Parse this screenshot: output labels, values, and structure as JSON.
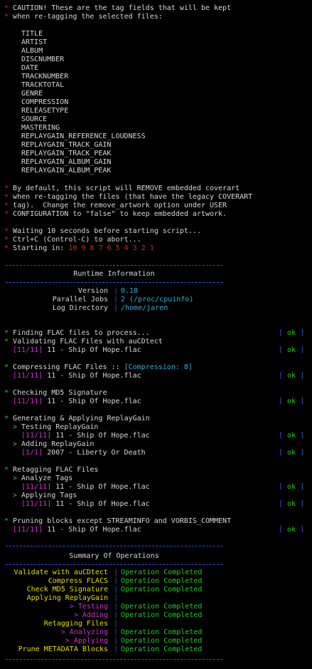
{
  "caution": {
    "line1": "CAUTION! These are the tag fields that will be kept",
    "line2": "when re-tagging the selected files:",
    "tags": [
      "TITLE",
      "ARTIST",
      "ALBUM",
      "DISCNUMBER",
      "DATE",
      "TRACKNUMBER",
      "TRACKTOTAL",
      "GENRE",
      "COMPRESSION",
      "RELEASETYPE",
      "SOURCE",
      "MASTERING",
      "REPLAYGAIN_REFERENCE_LOUDNESS",
      "REPLAYGAIN_TRACK_GAIN",
      "REPLAYGAIN_TRACK_PEAK",
      "REPLAYGAIN_ALBUM_GAIN",
      "REPLAYGAIN_ALBUM_PEAK"
    ]
  },
  "coverart": [
    "By default, this script will REMOVE embedded coverart",
    "when re-tagging the files (that have the legacy COVERART",
    "tag).  Change the remove_artwork option under USER",
    "CONFIGURATION to \"false\" to keep embedded artwork."
  ],
  "waiting": {
    "line1": "Waiting 10 seconds before starting script...",
    "line2": "Ctrl+C (Control-C) to abort...",
    "line3": "Starting in: ",
    "countdown": "10 9 8 7 6 5 4 3 2 1"
  },
  "runtime": {
    "title": "Runtime Information",
    "rows": [
      {
        "label": "Version",
        "value": "0.18"
      },
      {
        "label": "Parallel Jobs",
        "value": "2 (/proc/cpuinfo)"
      },
      {
        "label": "Log Directory",
        "value": "/home/jaren"
      }
    ]
  },
  "ok_label": "[ ok ]",
  "steps": {
    "finding": "Finding FLAC files to process...",
    "validating": "Validating FLAC Files with auCDtect",
    "counter": "[11/11]",
    "file": "11 - Ship Of Hope.flac",
    "compressing": "Compressing FLAC Files :: ",
    "compression_tag": "[Compression: 8]",
    "md5": "Checking MD5 Signature",
    "replaygain": "Generating & Applying ReplayGain",
    "testing_rg": "Testing ReplayGain",
    "adding_rg": "Adding ReplayGain",
    "album_counter": "[1/1]",
    "album": "2007 - Liberty Or Death",
    "retagging": "Retagging FLAC Files",
    "analyze": "Analyze Tags",
    "applying": "Applying Tags",
    "pruning": "Pruning blocks except STREAMINFO and VORBIS_COMMENT"
  },
  "summary": {
    "title": "Summary Of Operations",
    "rows": [
      {
        "label": "Validate with auCDtect",
        "value": "Operation Completed",
        "kind": "y"
      },
      {
        "label": "Compress FLACS",
        "value": "Operation Completed",
        "kind": "y"
      },
      {
        "label": "Check MD5 Signature",
        "value": "Operation Completed",
        "kind": "y"
      },
      {
        "label": "Applying ReplayGain",
        "value": "",
        "kind": "y"
      },
      {
        "label": "> Testing",
        "value": "Operation Completed",
        "kind": "m"
      },
      {
        "label": "> Adding",
        "value": "Operation Completed",
        "kind": "m"
      },
      {
        "label": "Retagging Files",
        "value": "",
        "kind": "y"
      },
      {
        "label": "> Analyzing",
        "value": "Operation Completed",
        "kind": "m"
      },
      {
        "label": "> Applying",
        "value": "Operation Completed",
        "kind": "m"
      },
      {
        "label": "Prune METADATA Blocks",
        "value": "Operation Completed",
        "kind": "y"
      }
    ]
  }
}
